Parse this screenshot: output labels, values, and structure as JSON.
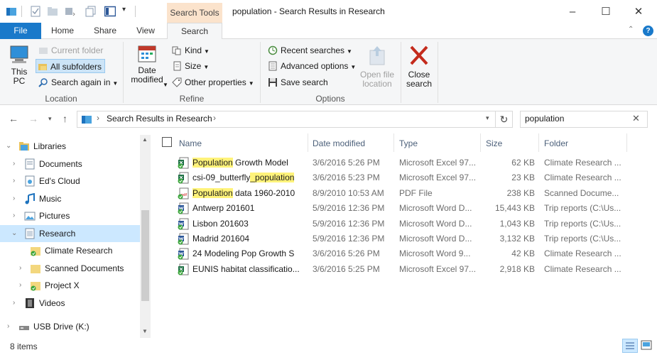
{
  "window": {
    "title": "population - Search Results in Research",
    "context_tab_group": "Search Tools",
    "controls": {
      "minimize": "–",
      "maximize": "☐",
      "close": "✕"
    }
  },
  "ribbon_tabs": [
    "File",
    "Home",
    "Share",
    "View",
    "Search"
  ],
  "ribbon": {
    "location": {
      "group_label": "Location",
      "this_pc": "This PC",
      "current_folder": "Current folder",
      "all_subfolders": "All subfolders",
      "search_again_in": "Search again in"
    },
    "refine": {
      "group_label": "Refine",
      "date_modified": "Date modified",
      "kind": "Kind",
      "size": "Size",
      "other_properties": "Other properties"
    },
    "options": {
      "group_label": "Options",
      "recent_searches": "Recent searches",
      "advanced_options": "Advanced options",
      "save_search": "Save search",
      "open_file_location": "Open file location"
    },
    "close": {
      "close_search": "Close search"
    }
  },
  "address": {
    "path": "Search Results in Research",
    "search_value": "population"
  },
  "nav_tree": [
    {
      "label": "Libraries",
      "icon": "libraries-icon"
    },
    {
      "label": "Documents",
      "icon": "documents-icon"
    },
    {
      "label": "Ed's Cloud",
      "icon": "cloud-folder-icon"
    },
    {
      "label": "Music",
      "icon": "music-icon"
    },
    {
      "label": "Pictures",
      "icon": "pictures-icon"
    },
    {
      "label": "Research",
      "icon": "library-icon",
      "selected": true
    },
    {
      "label": "Climate Research",
      "icon": "folder-synced-icon"
    },
    {
      "label": "Scanned Documents",
      "icon": "folder-icon"
    },
    {
      "label": "Project X",
      "icon": "folder-synced-icon"
    },
    {
      "label": "Videos",
      "icon": "videos-icon"
    },
    {
      "label": "USB Drive (K:)",
      "icon": "usb-drive-icon"
    }
  ],
  "columns": [
    "Name",
    "Date modified",
    "Type",
    "Size",
    "Folder"
  ],
  "files": [
    {
      "pre": "",
      "hl": "Population",
      "post": " Growth Model",
      "date": "3/6/2016 5:26 PM",
      "type": "Microsoft Excel 97...",
      "size": "62 KB",
      "folder": "Climate Research ...",
      "icon": "excel-file-icon"
    },
    {
      "pre": "csi-09_butterfly",
      "hl": "_population",
      "post": "",
      "date": "3/6/2016 5:23 PM",
      "type": "Microsoft Excel 97...",
      "size": "23 KB",
      "folder": "Climate Research ...",
      "icon": "excel-file-icon"
    },
    {
      "pre": "",
      "hl": "Population",
      "post": " data 1960-2010",
      "date": "8/9/2010 10:53 AM",
      "type": "PDF File",
      "size": "238 KB",
      "folder": "Scanned Docume...",
      "icon": "pdf-file-icon"
    },
    {
      "pre": "Antwerp 201601",
      "hl": "",
      "post": "",
      "date": "5/9/2016 12:36 PM",
      "type": "Microsoft Word D...",
      "size": "15,443 KB",
      "folder": "Trip reports (C:\\Us...",
      "icon": "word-file-icon"
    },
    {
      "pre": "Lisbon 201603",
      "hl": "",
      "post": "",
      "date": "5/9/2016 12:36 PM",
      "type": "Microsoft Word D...",
      "size": "1,043 KB",
      "folder": "Trip reports (C:\\Us...",
      "icon": "word-file-icon"
    },
    {
      "pre": "Madrid 201604",
      "hl": "",
      "post": "",
      "date": "5/9/2016 12:36 PM",
      "type": "Microsoft Word D...",
      "size": "3,132 KB",
      "folder": "Trip reports (C:\\Us...",
      "icon": "word-file-icon"
    },
    {
      "pre": "24 Modeling Pop Growth S",
      "hl": "",
      "post": "",
      "date": "3/6/2016 5:26 PM",
      "type": "Microsoft Word 9...",
      "size": "42 KB",
      "folder": "Climate Research ...",
      "icon": "word-file-icon"
    },
    {
      "pre": "EUNIS habitat classificatio...",
      "hl": "",
      "post": "",
      "date": "3/6/2016 5:25 PM",
      "type": "Microsoft Excel 97...",
      "size": "2,918 KB",
      "folder": "Climate Research ...",
      "icon": "excel-file-icon"
    }
  ],
  "status": {
    "item_count": "8 items"
  },
  "colors": {
    "accent": "#1979ca",
    "highlight": "#fff37a",
    "selection": "#cce8ff",
    "close_red": "#c42b1c"
  }
}
